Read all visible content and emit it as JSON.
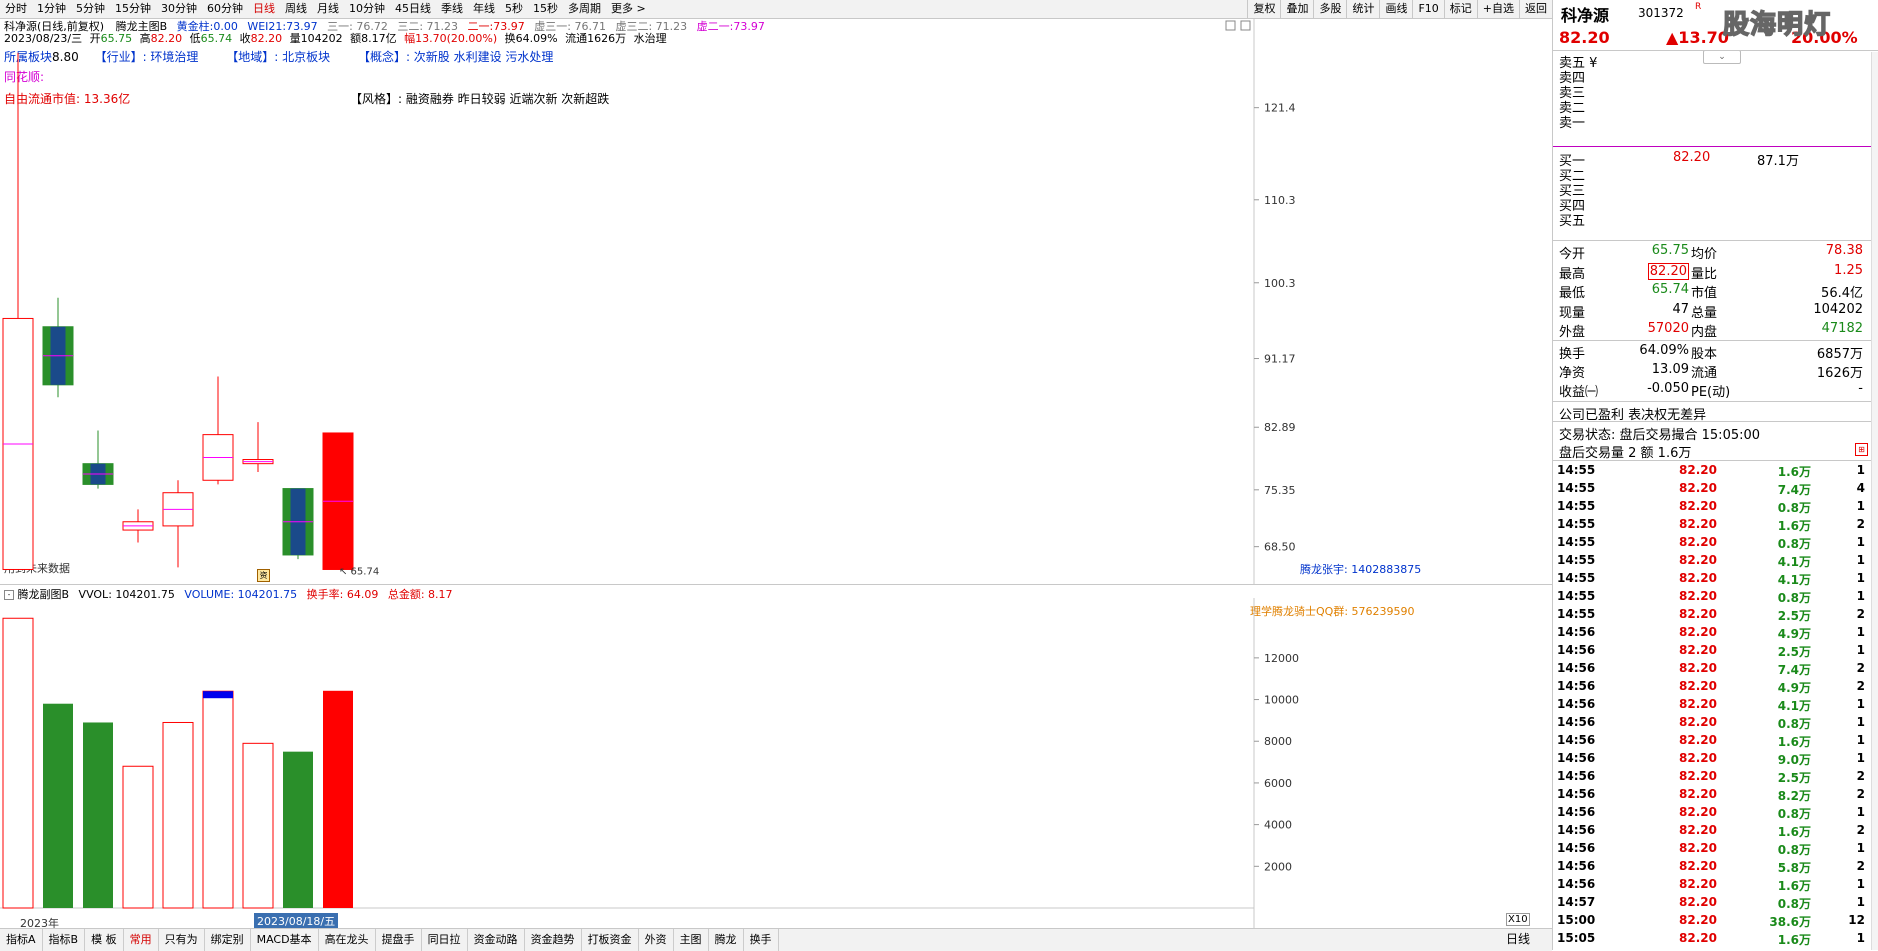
{
  "periods": [
    "分时",
    "1分钟",
    "5分钟",
    "15分钟",
    "30分钟",
    "60分钟",
    "日线",
    "周线",
    "月线",
    "10分钟",
    "45日线",
    "季线",
    "年线",
    "5秒",
    "15秒",
    "多周期",
    "更多 >"
  ],
  "active_period": "日线",
  "toolbar": [
    "复权",
    "叠加",
    "多股",
    "统计",
    "画线",
    "F10",
    "标记",
    "+自选",
    "返回"
  ],
  "main": {
    "title": "科净源(日线,前复权)",
    "indicator": "腾龙主图B",
    "gold_label": "黄金柱:",
    "gold_val": "0.00",
    "wei_label": "WEI21:",
    "wei_val": "73.97",
    "s1": "三一: 76.72",
    "s2": "三二: 71.23",
    "s3_label": "二一:",
    "s3_val": "73.97",
    "s4": "虚三一: 76.71",
    "s5": "虚三二: 71.23",
    "s6_label": "虚二一:",
    "s6_val": "73.97",
    "date": "2023/08/23/三",
    "open_label": "开",
    "open": "65.75",
    "high_label": "高",
    "high": "82.20",
    "low_label": "低",
    "low": "65.74",
    "close_label": "收",
    "close": "82.20",
    "vol": "量104202",
    "amt": "额8.17亿",
    "chg": "幅13.70(20.00%)",
    "turn": "换64.09%",
    "float": "流通1626万",
    "sector_tag": "水治理",
    "board_label": "所属板块",
    "board_val": "8.80",
    "industry": "【行业】: 环境治理",
    "region": "【地域】: 北京板块",
    "concept": "【概念】: 次新股 水利建设 污水处理",
    "ths": "同花顺:",
    "free_cap": "自由流通市值: 13.36亿",
    "style": "【风格】: 融资融券 昨日较弱 近端次新 次新超跌",
    "future_note": "用到未来数据",
    "author": "腾龙张宇: 1402883875",
    "low_marker": "65.74",
    "y_ticks": [
      "121.4",
      "110.3",
      "100.3",
      "91.17",
      "82.89",
      "75.35",
      "68.50"
    ]
  },
  "sub": {
    "indicator": "腾龙副图B",
    "vvol": "VVOL: 104201.75",
    "volume": "VOLUME: 104201.75",
    "turnover": "换手率: 64.09",
    "amount": "总金额: 8.17",
    "qq": "理学腾龙骑士QQ群: 576239590",
    "y_ticks": [
      "12000",
      "10000",
      "8000",
      "6000",
      "4000",
      "2000"
    ],
    "x10": "X10",
    "year": "2023年",
    "cursor_date": "2023/08/18/五",
    "period_btn": "日线"
  },
  "chart_data": {
    "type": "candlestick",
    "title": "科净源(日线,前复权)",
    "candles": [
      {
        "o": 65.75,
        "h": 128.0,
        "l": 65.74,
        "c": 96.0,
        "dir": "up"
      },
      {
        "o": 95.0,
        "h": 98.5,
        "l": 86.5,
        "c": 88.0,
        "dir": "down"
      },
      {
        "o": 78.5,
        "h": 82.5,
        "l": 75.5,
        "c": 76.0,
        "dir": "down"
      },
      {
        "o": 70.5,
        "h": 73.0,
        "l": 69.0,
        "c": 71.5,
        "dir": "up"
      },
      {
        "o": 71.0,
        "h": 76.5,
        "l": 66.0,
        "c": 75.0,
        "dir": "up"
      },
      {
        "o": 76.5,
        "h": 89.0,
        "l": 76.0,
        "c": 82.0,
        "dir": "up"
      },
      {
        "o": 78.5,
        "h": 83.5,
        "l": 77.5,
        "c": 79.0,
        "dir": "up"
      },
      {
        "o": 75.5,
        "h": 75.5,
        "l": 67.0,
        "c": 67.5,
        "dir": "down"
      },
      {
        "o": 65.75,
        "h": 82.2,
        "l": 65.74,
        "c": 82.2,
        "dir": "up"
      }
    ],
    "volume": [
      {
        "v": 13900,
        "dir": "up"
      },
      {
        "v": 9800,
        "dir": "down"
      },
      {
        "v": 8900,
        "dir": "down"
      },
      {
        "v": 6800,
        "dir": "up"
      },
      {
        "v": 8900,
        "dir": "up"
      },
      {
        "v": 10400,
        "dir": "up"
      },
      {
        "v": 7900,
        "dir": "up"
      },
      {
        "v": 7500,
        "dir": "down"
      },
      {
        "v": 10420,
        "dir": "up"
      }
    ],
    "ylim": [
      64,
      131
    ],
    "vol_ylim": [
      0,
      14200
    ],
    "colors": {
      "up": "#ff0000",
      "down": "#2a8f2a",
      "body_dark": "#1a4a8a",
      "mid": "#ff00ff"
    }
  },
  "quote": {
    "name": "科净源",
    "code": "301372",
    "badge": "R",
    "price": "82.20",
    "change": "▲13.70",
    "pct": "20.00%",
    "asks": [
      "卖五 ¥",
      "卖四",
      "卖三",
      "卖二",
      "卖一"
    ],
    "bids": [
      {
        "label": "买一",
        "price": "82.20",
        "vol": "87.1万"
      },
      {
        "label": "买二",
        "price": "",
        "vol": ""
      },
      {
        "label": "买三",
        "price": "",
        "vol": ""
      },
      {
        "label": "买四",
        "price": "",
        "vol": ""
      },
      {
        "label": "买五",
        "price": "",
        "vol": ""
      }
    ],
    "stats": [
      {
        "l1": "今开",
        "v1": "65.75",
        "l2": "均价",
        "v2": "78.38",
        "c1": "green",
        "c2": "red"
      },
      {
        "l1": "最高",
        "v1": "82.20",
        "l2": "量比",
        "v2": "1.25",
        "c1": "red",
        "c2": "red"
      },
      {
        "l1": "最低",
        "v1": "65.74",
        "l2": "市值",
        "v2": "56.4亿",
        "c1": "green",
        "c2": ""
      },
      {
        "l1": "现量",
        "v1": "47",
        "l2": "总量",
        "v2": "104202",
        "c1": "",
        "c2": ""
      },
      {
        "l1": "外盘",
        "v1": "57020",
        "l2": "内盘",
        "v2": "47182",
        "c1": "red",
        "c2": "green"
      },
      {
        "l1": "换手",
        "v1": "64.09%",
        "l2": "股本",
        "v2": "6857万",
        "c1": "",
        "c2": ""
      },
      {
        "l1": "净资",
        "v1": "13.09",
        "l2": "流通",
        "v2": "1626万",
        "c1": "",
        "c2": ""
      },
      {
        "l1": "收益㈠",
        "v1": "-0.050",
        "l2": "PE(动)",
        "v2": "-",
        "c1": "",
        "c2": ""
      }
    ],
    "company_note": "公司已盈利 表决权无差异",
    "status": "交易状态: 盘后交易撮合 15:05:00",
    "after_hours": "盘后交易量 2 额 1.6万",
    "ticks": [
      [
        "14:55",
        "82.20",
        "1.6万",
        "1"
      ],
      [
        "14:55",
        "82.20",
        "7.4万",
        "4"
      ],
      [
        "14:55",
        "82.20",
        "0.8万",
        "1"
      ],
      [
        "14:55",
        "82.20",
        "1.6万",
        "2"
      ],
      [
        "14:55",
        "82.20",
        "0.8万",
        "1"
      ],
      [
        "14:55",
        "82.20",
        "4.1万",
        "1"
      ],
      [
        "14:55",
        "82.20",
        "4.1万",
        "1"
      ],
      [
        "14:55",
        "82.20",
        "0.8万",
        "1"
      ],
      [
        "14:55",
        "82.20",
        "2.5万",
        "2"
      ],
      [
        "14:56",
        "82.20",
        "4.9万",
        "1"
      ],
      [
        "14:56",
        "82.20",
        "2.5万",
        "1"
      ],
      [
        "14:56",
        "82.20",
        "7.4万",
        "2"
      ],
      [
        "14:56",
        "82.20",
        "4.9万",
        "2"
      ],
      [
        "14:56",
        "82.20",
        "4.1万",
        "1"
      ],
      [
        "14:56",
        "82.20",
        "0.8万",
        "1"
      ],
      [
        "14:56",
        "82.20",
        "1.6万",
        "1"
      ],
      [
        "14:56",
        "82.20",
        "9.0万",
        "1"
      ],
      [
        "14:56",
        "82.20",
        "2.5万",
        "2"
      ],
      [
        "14:56",
        "82.20",
        "8.2万",
        "2"
      ],
      [
        "14:56",
        "82.20",
        "0.8万",
        "1"
      ],
      [
        "14:56",
        "82.20",
        "1.6万",
        "2"
      ],
      [
        "14:56",
        "82.20",
        "0.8万",
        "1"
      ],
      [
        "14:56",
        "82.20",
        "5.8万",
        "2"
      ],
      [
        "14:56",
        "82.20",
        "1.6万",
        "1"
      ],
      [
        "14:57",
        "82.20",
        "0.8万",
        "1"
      ],
      [
        "15:00",
        "82.20",
        "38.6万",
        "12"
      ],
      [
        "15:05",
        "82.20",
        "1.6万",
        "1"
      ]
    ]
  },
  "watermark": "股海明灯",
  "bottom_tabs": [
    "指标A",
    "指标B",
    "模 板",
    "常用",
    "只有为",
    "绑定别",
    "MACD基本",
    "高在龙头",
    "提盘手",
    "同日拉",
    "资金动路",
    "资金趋势",
    "打板资金",
    "外资",
    "主图",
    "腾龙",
    "换手"
  ],
  "active_bottom": "常用"
}
